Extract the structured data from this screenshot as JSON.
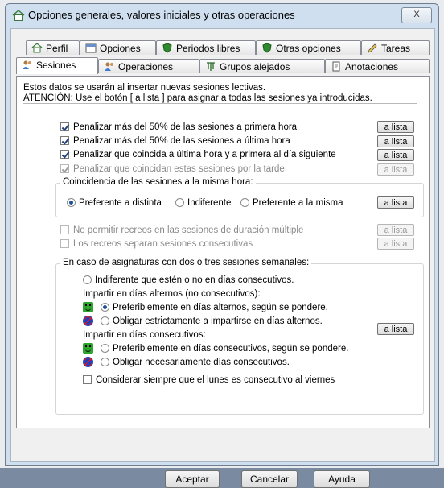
{
  "window": {
    "title": "Opciones generales, valores iniciales y otras operaciones",
    "close_label": "X"
  },
  "tabs_row1": [
    {
      "label": "Perfil"
    },
    {
      "label": "Opciones"
    },
    {
      "label": "Periodos libres"
    },
    {
      "label": "Otras opciones"
    },
    {
      "label": "Tareas"
    }
  ],
  "tabs_row2": [
    {
      "label": "Sesiones"
    },
    {
      "label": "Operaciones"
    },
    {
      "label": "Grupos alejados"
    },
    {
      "label": "Anotaciones"
    }
  ],
  "info": {
    "line1": "Estos datos se usarán al insertar nuevas sesiones lectivas.",
    "line2": "ATENCIÓN: Use el botón [ a lista ] para asignar a todas las sesiones ya introducidas."
  },
  "checks": [
    {
      "label": "Penalizar más del 50% de las sesiones a primera hora",
      "checked": true,
      "enabled": true
    },
    {
      "label": "Penalizar más del 50% de las sesiones a última hora",
      "checked": true,
      "enabled": true
    },
    {
      "label": "Penalizar que coincida a última hora y a primera al día siguiente",
      "checked": true,
      "enabled": true
    },
    {
      "label": "Penalizar que coincidan estas sesiones por la tarde",
      "checked": true,
      "enabled": false
    }
  ],
  "a_lista_label": "a lista",
  "coincidencia": {
    "title": "Coincidencia de las sesiones a la misma hora:",
    "options": [
      "Preferente a distinta",
      "Indiferente",
      "Preferente a la misma"
    ],
    "selected": "Preferente a distinta"
  },
  "recreos": [
    {
      "label": "No permitir recreos en las sesiones de duración múltiple",
      "checked": false
    },
    {
      "label": "Los recreos separan sesiones consecutivas",
      "checked": false
    }
  ],
  "asignaturas": {
    "title": "En caso de asignaturas con dos o tres sesiones semanales:",
    "indiferente": "Indiferente que estén o no en días consecutivos.",
    "alternos_heading": "Impartir en días alternos (no consecutivos):",
    "alternos_pref": "Preferiblemente en días alternos, según se pondere.",
    "alternos_oblig": "Obligar estrictamente a impartirse en días alternos.",
    "consecutivos_heading": "Impartir en días consecutivos:",
    "consecutivos_pref": "Preferiblemente en días consecutivos, según se pondere.",
    "consecutivos_oblig": "Obligar necesariamente días consecutivos.",
    "lunes": "Considerar siempre que el lunes es consecutivo al viernes",
    "selected": "alternos_pref"
  },
  "buttons": {
    "accept": "Aceptar",
    "cancel": "Cancelar",
    "help": "Ayuda"
  }
}
